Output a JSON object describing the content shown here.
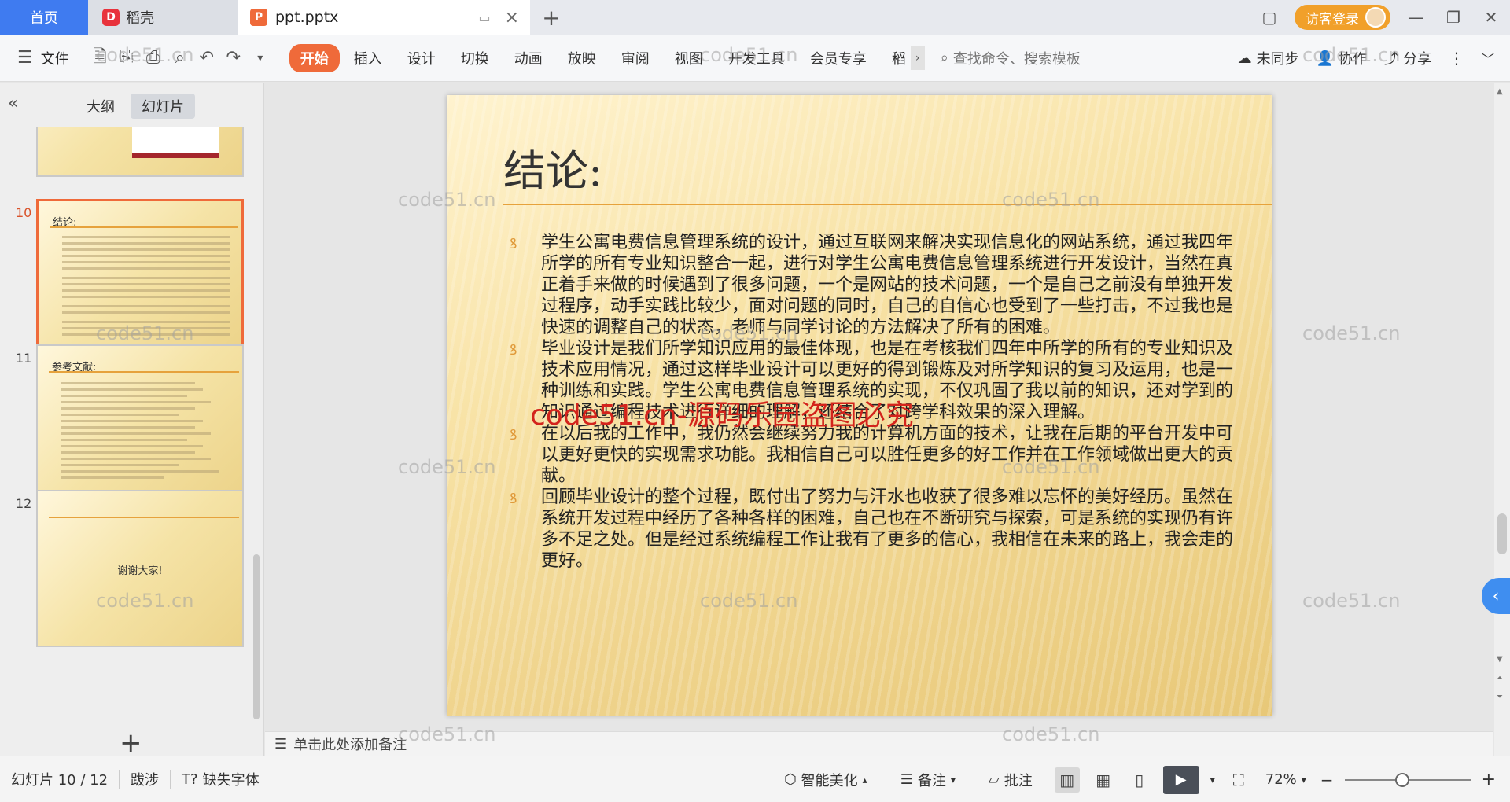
{
  "tabs": {
    "home": "首页",
    "app": "稻壳",
    "doc": "ppt.pptx"
  },
  "window": {
    "login_label": "访客登录"
  },
  "toolbar": {
    "file": "文件",
    "tabs": [
      "开始",
      "插入",
      "设计",
      "切换",
      "动画",
      "放映",
      "审阅",
      "视图",
      "开发工具",
      "会员专享",
      "稻"
    ],
    "active_tab": "开始",
    "search_placeholder": "查找命令、搜索模板",
    "sync": "未同步",
    "collab": "协作",
    "share": "分享"
  },
  "left_panel": {
    "view_tabs": [
      "大纲",
      "幻灯片"
    ],
    "active_view": "幻灯片",
    "slides": [
      {
        "num": "",
        "title": ""
      },
      {
        "num": "10",
        "title": "结论:"
      },
      {
        "num": "11",
        "title": "参考文献:"
      },
      {
        "num": "12",
        "title": "",
        "center_text": "谢谢大家!"
      }
    ],
    "current_slide": "10"
  },
  "slide": {
    "title": "结论:",
    "bullets": [
      "学生公寓电费信息管理系统的设计，通过互联网来解决实现信息化的网站系统，通过我四年所学的所有专业知识整合一起，进行对学生公寓电费信息管理系统进行开发设计，当然在真正着手来做的时候遇到了很多问题，一个是网站的技术问题，一个是自己之前没有单独开发过程序，动手实践比较少，面对问题的同时，自己的自信心也受到了一些打击，不过我也是快速的调整自己的状态，老师与同学讨论的方法解决了所有的困难。",
      "毕业设计是我们所学知识应用的最佳体现，也是在考核我们四年中所学的所有的专业知识及技术应用情况，通过这样毕业设计可以更好的得到锻炼及对所学知识的复习及运用，也是一种训练和实践。学生公寓电费信息管理系统的实现，不仅巩固了我以前的知识，还对学到的知识通过编程技术进行详细的理解，还结合了对跨学科效果的深入理解。",
      "在以后我的工作中，我仍然会继续努力我的计算机方面的技术，让我在后期的平台开发中可以更好更快的实现需求功能。我相信自己可以胜任更多的好工作并在工作领域做出更大的贡献。",
      "回顾毕业设计的整个过程，既付出了努力与汗水也收获了很多难以忘怀的美好经历。虽然在系统开发过程中经历了各种各样的困难，自己也在不断研究与探索，可是系统的实现仍有许多不足之处。但是经过系统编程工作让我有了更多的信心，我相信在未来的路上，我会走的更好。"
    ],
    "overlay_watermark": "code51.cn-源码乐园盗图必究"
  },
  "notes": {
    "placeholder": "单击此处添加备注"
  },
  "status": {
    "slide_info": "幻灯片 10 / 12",
    "theme": "跋涉",
    "missing_font": "缺失字体",
    "beautify": "智能美化",
    "notes": "备注",
    "comments": "批注",
    "zoom": "72%"
  },
  "watermark": "code51.cn",
  "colors": {
    "accent": "#ef6a3a",
    "home_tab": "#3f7bf0",
    "login": "#f1a02a",
    "slide_rule": "#e6a23c"
  }
}
